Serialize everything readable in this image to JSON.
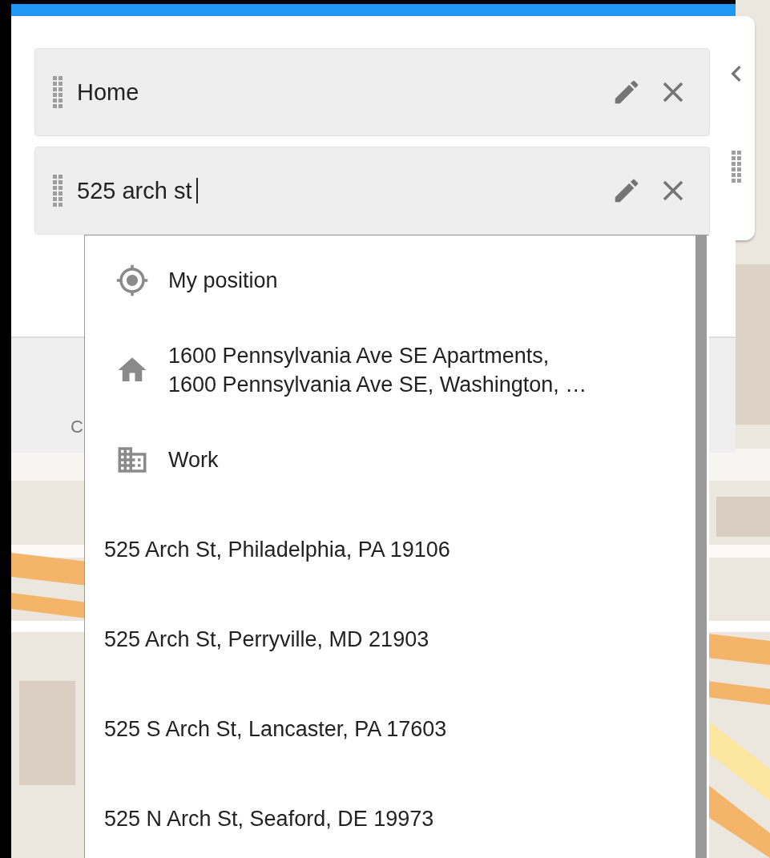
{
  "waypoints": [
    {
      "text": "Home",
      "editing": false
    },
    {
      "text": "525 arch st",
      "editing": true
    }
  ],
  "toolbar": {
    "item_label": "C"
  },
  "suggestions": [
    {
      "kind": "location",
      "label": "My position"
    },
    {
      "kind": "home",
      "label": "1600 Pennsylvania Ave SE Apartments,",
      "detail": "1600 Pennsylvania Ave SE, Washington, …"
    },
    {
      "kind": "work",
      "label": "Work"
    },
    {
      "kind": "address",
      "label": "525 Arch St, Philadelphia, PA 19106"
    },
    {
      "kind": "address",
      "label": "525 Arch St, Perryville, MD 21903"
    },
    {
      "kind": "address",
      "label": "525 S Arch St, Lancaster, PA 17603"
    },
    {
      "kind": "address",
      "label": "525 N Arch St, Seaford, DE 19973"
    }
  ]
}
